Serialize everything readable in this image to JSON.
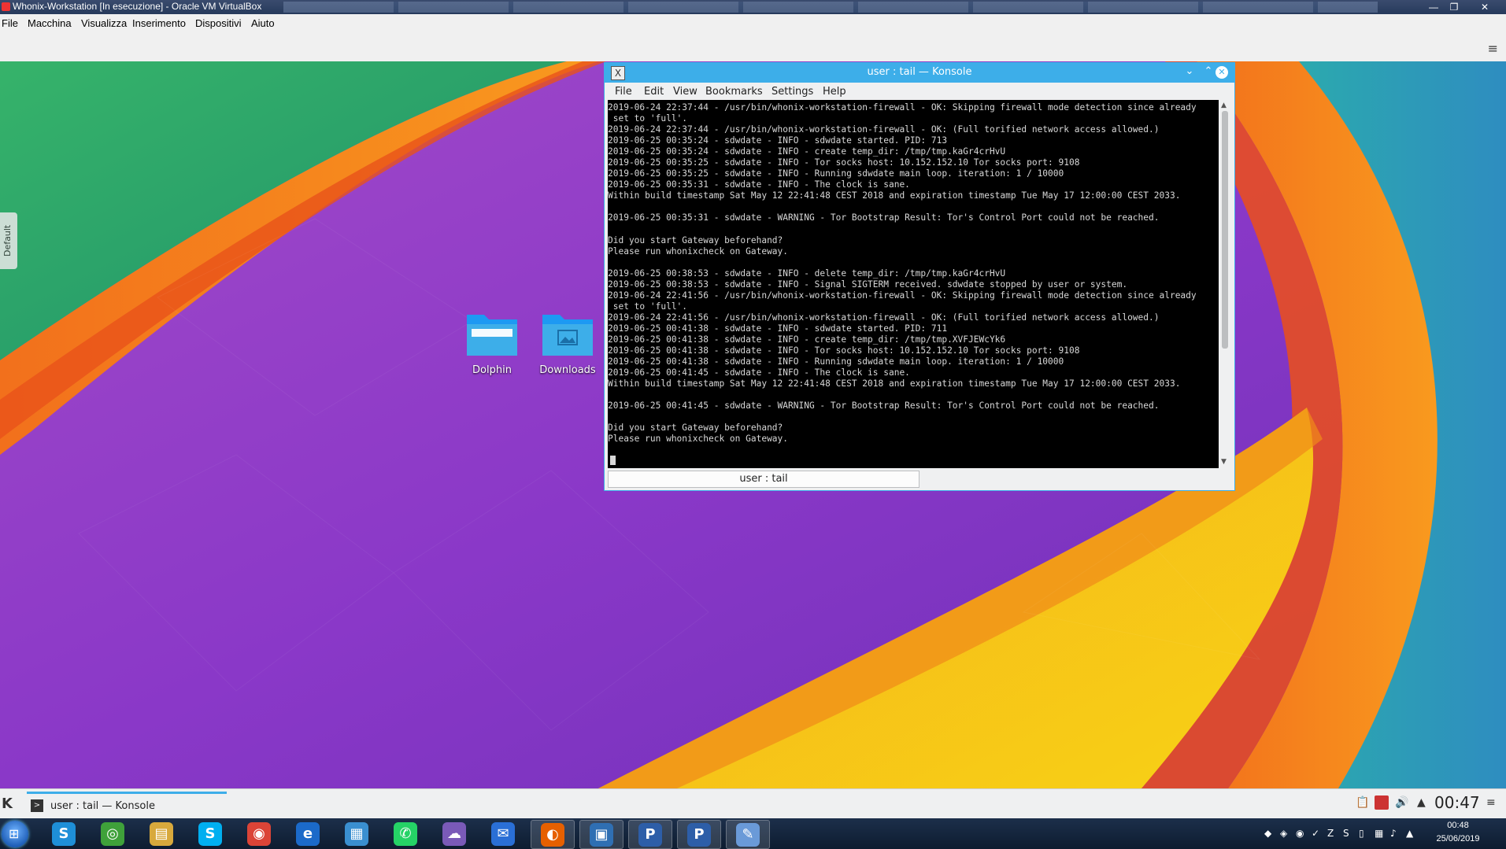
{
  "host": {
    "window_title": "Whonix-Workstation [In esecuzione] - Oracle VM VirtualBox",
    "menu": [
      "File",
      "Macchina",
      "Visualizza",
      "Inserimento",
      "Dispositivi",
      "Aiuto"
    ]
  },
  "desktop": {
    "activity_tab": "Default",
    "icons": [
      {
        "label": "Dolphin",
        "icon": "folder-icon"
      },
      {
        "label": "Downloads",
        "icon": "folder-images-icon"
      }
    ]
  },
  "konsole": {
    "title": "user : tail — Konsole",
    "menu": [
      "File",
      "Edit",
      "View",
      "Bookmarks",
      "Settings",
      "Help"
    ],
    "terminal_lines": [
      "2019-06-24 22:37:44 - /usr/bin/whonix-workstation-firewall - OK: Skipping firewall mode detection since already",
      " set to 'full'.",
      "2019-06-24 22:37:44 - /usr/bin/whonix-workstation-firewall - OK: (Full torified network access allowed.)",
      "2019-06-25 00:35:24 - sdwdate - INFO - sdwdate started. PID: 713",
      "2019-06-25 00:35:24 - sdwdate - INFO - create temp_dir: /tmp/tmp.kaGr4crHvU",
      "2019-06-25 00:35:25 - sdwdate - INFO - Tor socks host: 10.152.152.10 Tor socks port: 9108",
      "2019-06-25 00:35:25 - sdwdate - INFO - Running sdwdate main loop. iteration: 1 / 10000",
      "2019-06-25 00:35:31 - sdwdate - INFO - The clock is sane.",
      "Within build timestamp Sat May 12 22:41:48 CEST 2018 and expiration timestamp Tue May 17 12:00:00 CEST 2033.",
      "",
      "2019-06-25 00:35:31 - sdwdate - WARNING - Tor Bootstrap Result: Tor's Control Port could not be reached.",
      "",
      "Did you start Gateway beforehand?",
      "Please run whonixcheck on Gateway.",
      "",
      "2019-06-25 00:38:53 - sdwdate - INFO - delete temp_dir: /tmp/tmp.kaGr4crHvU",
      "2019-06-25 00:38:53 - sdwdate - INFO - Signal SIGTERM received. sdwdate stopped by user or system.",
      "2019-06-24 22:41:56 - /usr/bin/whonix-workstation-firewall - OK: Skipping firewall mode detection since already",
      " set to 'full'.",
      "2019-06-24 22:41:56 - /usr/bin/whonix-workstation-firewall - OK: (Full torified network access allowed.)",
      "2019-06-25 00:41:38 - sdwdate - INFO - sdwdate started. PID: 711",
      "2019-06-25 00:41:38 - sdwdate - INFO - create temp_dir: /tmp/tmp.XVFJEWcYk6",
      "2019-06-25 00:41:38 - sdwdate - INFO - Tor socks host: 10.152.152.10 Tor socks port: 9108",
      "2019-06-25 00:41:38 - sdwdate - INFO - Running sdwdate main loop. iteration: 1 / 10000",
      "2019-06-25 00:41:45 - sdwdate - INFO - The clock is sane.",
      "Within build timestamp Sat May 12 22:41:48 CEST 2018 and expiration timestamp Tue May 17 12:00:00 CEST 2033.",
      "",
      "2019-06-25 00:41:45 - sdwdate - WARNING - Tor Bootstrap Result: Tor's Control Port could not be reached.",
      "",
      "Did you start Gateway beforehand?",
      "Please run whonixcheck on Gateway."
    ],
    "tab_label": "user : tail"
  },
  "kde_panel": {
    "task_label": "user : tail — Konsole",
    "clock": "00:47"
  },
  "windows_taskbar": {
    "apps": [
      {
        "name": "skype-alt-icon",
        "glyph": "S",
        "color": "#1e8fd8"
      },
      {
        "name": "greenshot-icon",
        "glyph": "◎",
        "color": "#3fa13a"
      },
      {
        "name": "file-explorer-icon",
        "glyph": "▤",
        "color": "#d8a93c"
      },
      {
        "name": "skype-icon",
        "glyph": "S",
        "color": "#00aff0"
      },
      {
        "name": "chrome-icon",
        "glyph": "◉",
        "color": "#db4437"
      },
      {
        "name": "internet-explorer-icon",
        "glyph": "e",
        "color": "#1b6ac9"
      },
      {
        "name": "building-app-icon",
        "glyph": "▦",
        "color": "#3a8fd0"
      },
      {
        "name": "whatsapp-icon",
        "glyph": "✆",
        "color": "#25d366"
      },
      {
        "name": "chat-app-icon",
        "glyph": "☁",
        "color": "#7a5ab8"
      },
      {
        "name": "thunderbird-icon",
        "glyph": "✉",
        "color": "#2a6fd6"
      },
      {
        "name": "firefox-icon",
        "glyph": "◐",
        "color": "#e66000"
      },
      {
        "name": "virtualbox-icon",
        "glyph": "▣",
        "color": "#2f6fb3"
      },
      {
        "name": "putty-icon-1",
        "glyph": "P",
        "color": "#2d5ea8"
      },
      {
        "name": "putty-icon-2",
        "glyph": "P",
        "color": "#2d5ea8"
      },
      {
        "name": "paint-icon",
        "glyph": "✎",
        "color": "#6a9ad8"
      }
    ],
    "time": "00:48",
    "date": "25/06/2019"
  }
}
